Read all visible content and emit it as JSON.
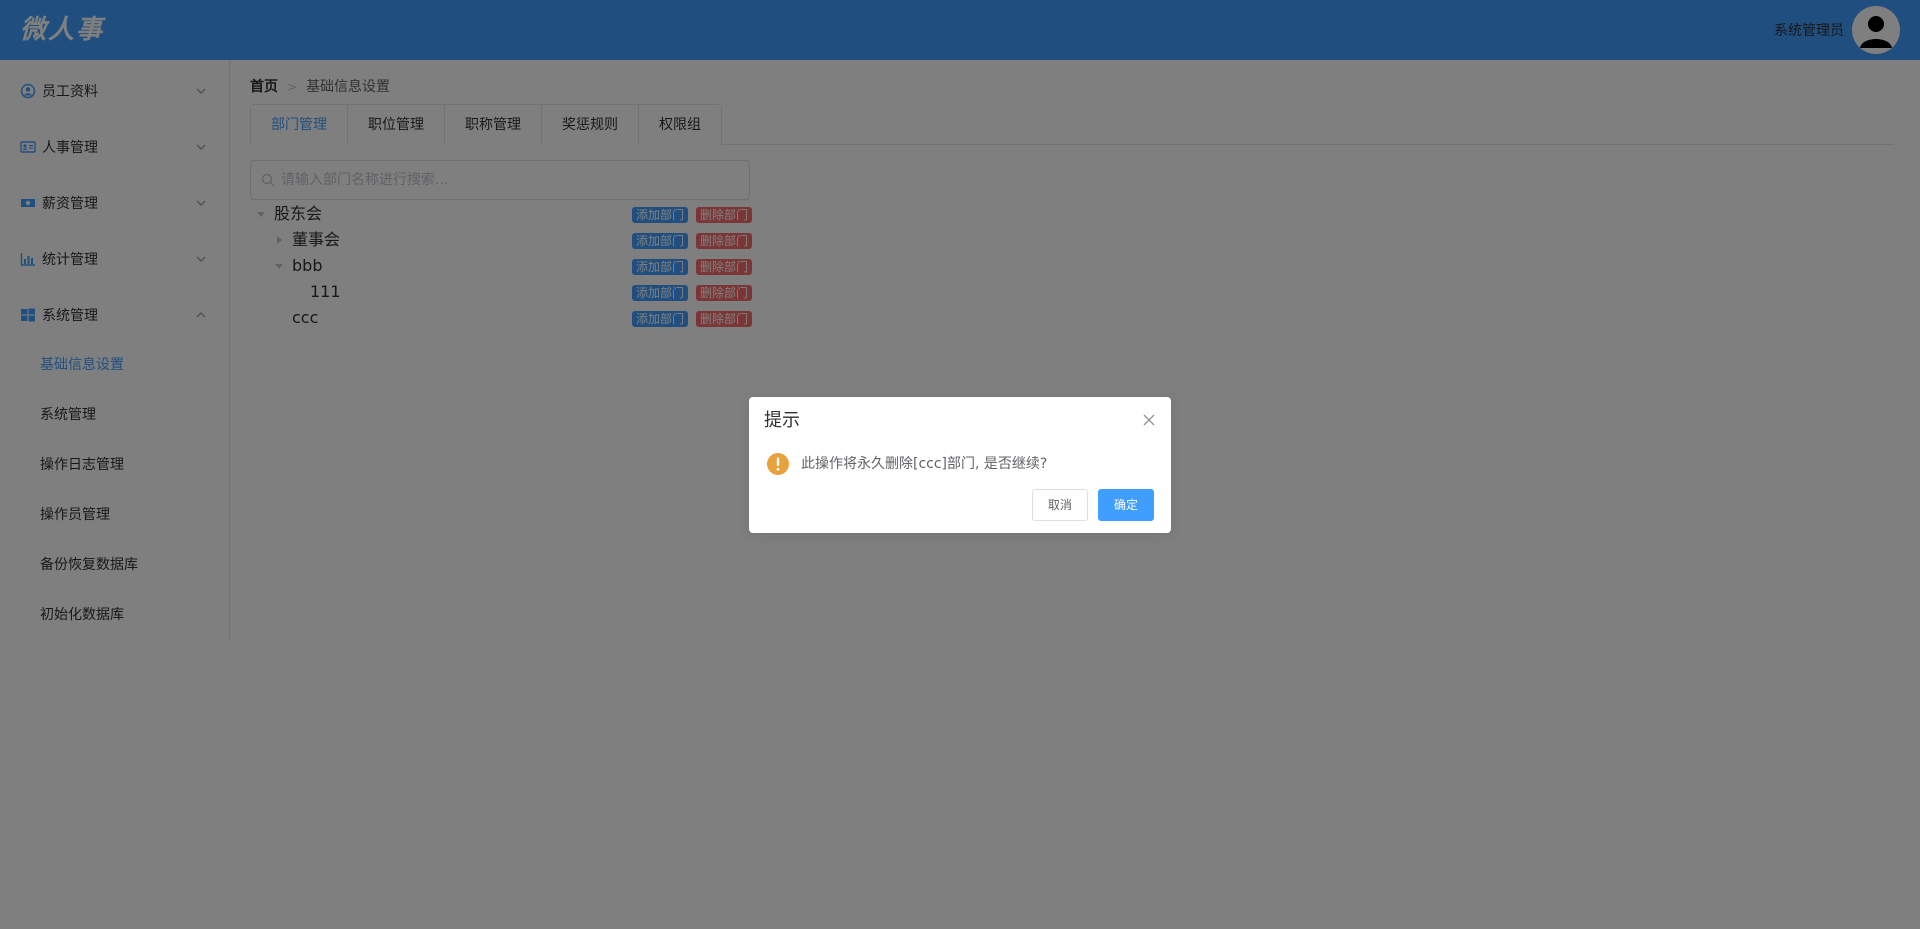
{
  "header": {
    "logo": "微人事",
    "user_name": "系统管理员",
    "avatar_icon": "user-avatar-icon"
  },
  "sidebar": {
    "groups": [
      {
        "label": "员工资料",
        "icon": "user-circle-icon",
        "expanded": false
      },
      {
        "label": "人事管理",
        "icon": "id-card-icon",
        "expanded": false
      },
      {
        "label": "薪资管理",
        "icon": "money-icon",
        "expanded": false
      },
      {
        "label": "统计管理",
        "icon": "bar-chart-icon",
        "expanded": false
      },
      {
        "label": "系统管理",
        "icon": "windows-icon",
        "expanded": true
      }
    ],
    "items": [
      {
        "label": "基础信息设置",
        "active": true
      },
      {
        "label": "系统管理",
        "active": false
      },
      {
        "label": "操作日志管理",
        "active": false
      },
      {
        "label": "操作员管理",
        "active": false
      },
      {
        "label": "备份恢复数据库",
        "active": false
      },
      {
        "label": "初始化数据库",
        "active": false
      }
    ]
  },
  "breadcrumb": {
    "home": "首页",
    "separator": ">",
    "current": "基础信息设置"
  },
  "tabs": [
    {
      "label": "部门管理",
      "active": true
    },
    {
      "label": "职位管理",
      "active": false
    },
    {
      "label": "职称管理",
      "active": false
    },
    {
      "label": "奖惩规则",
      "active": false
    },
    {
      "label": "权限组",
      "active": false
    }
  ],
  "search": {
    "placeholder": "请输入部门名称进行搜索...",
    "value": ""
  },
  "tree": {
    "add_label": "添加部门",
    "delete_label": "删除部门",
    "nodes": [
      {
        "label": "股东会",
        "level": 0,
        "caret": "expanded"
      },
      {
        "label": "董事会",
        "level": 1,
        "caret": "collapsed"
      },
      {
        "label": "bbb",
        "level": 1,
        "caret": "expanded"
      },
      {
        "label": "111",
        "level": 2,
        "caret": "none"
      },
      {
        "label": "ccc",
        "level": 1,
        "caret": "none"
      }
    ]
  },
  "dialog": {
    "title": "提示",
    "message": "此操作将永久删除[ccc]部门, 是否继续?",
    "cancel_label": "取消",
    "confirm_label": "确定"
  },
  "colors": {
    "primary": "#409eff",
    "danger": "#f56c6c",
    "warning": "#e6a23c",
    "overlay": "rgba(0,0,0,0.5)"
  }
}
